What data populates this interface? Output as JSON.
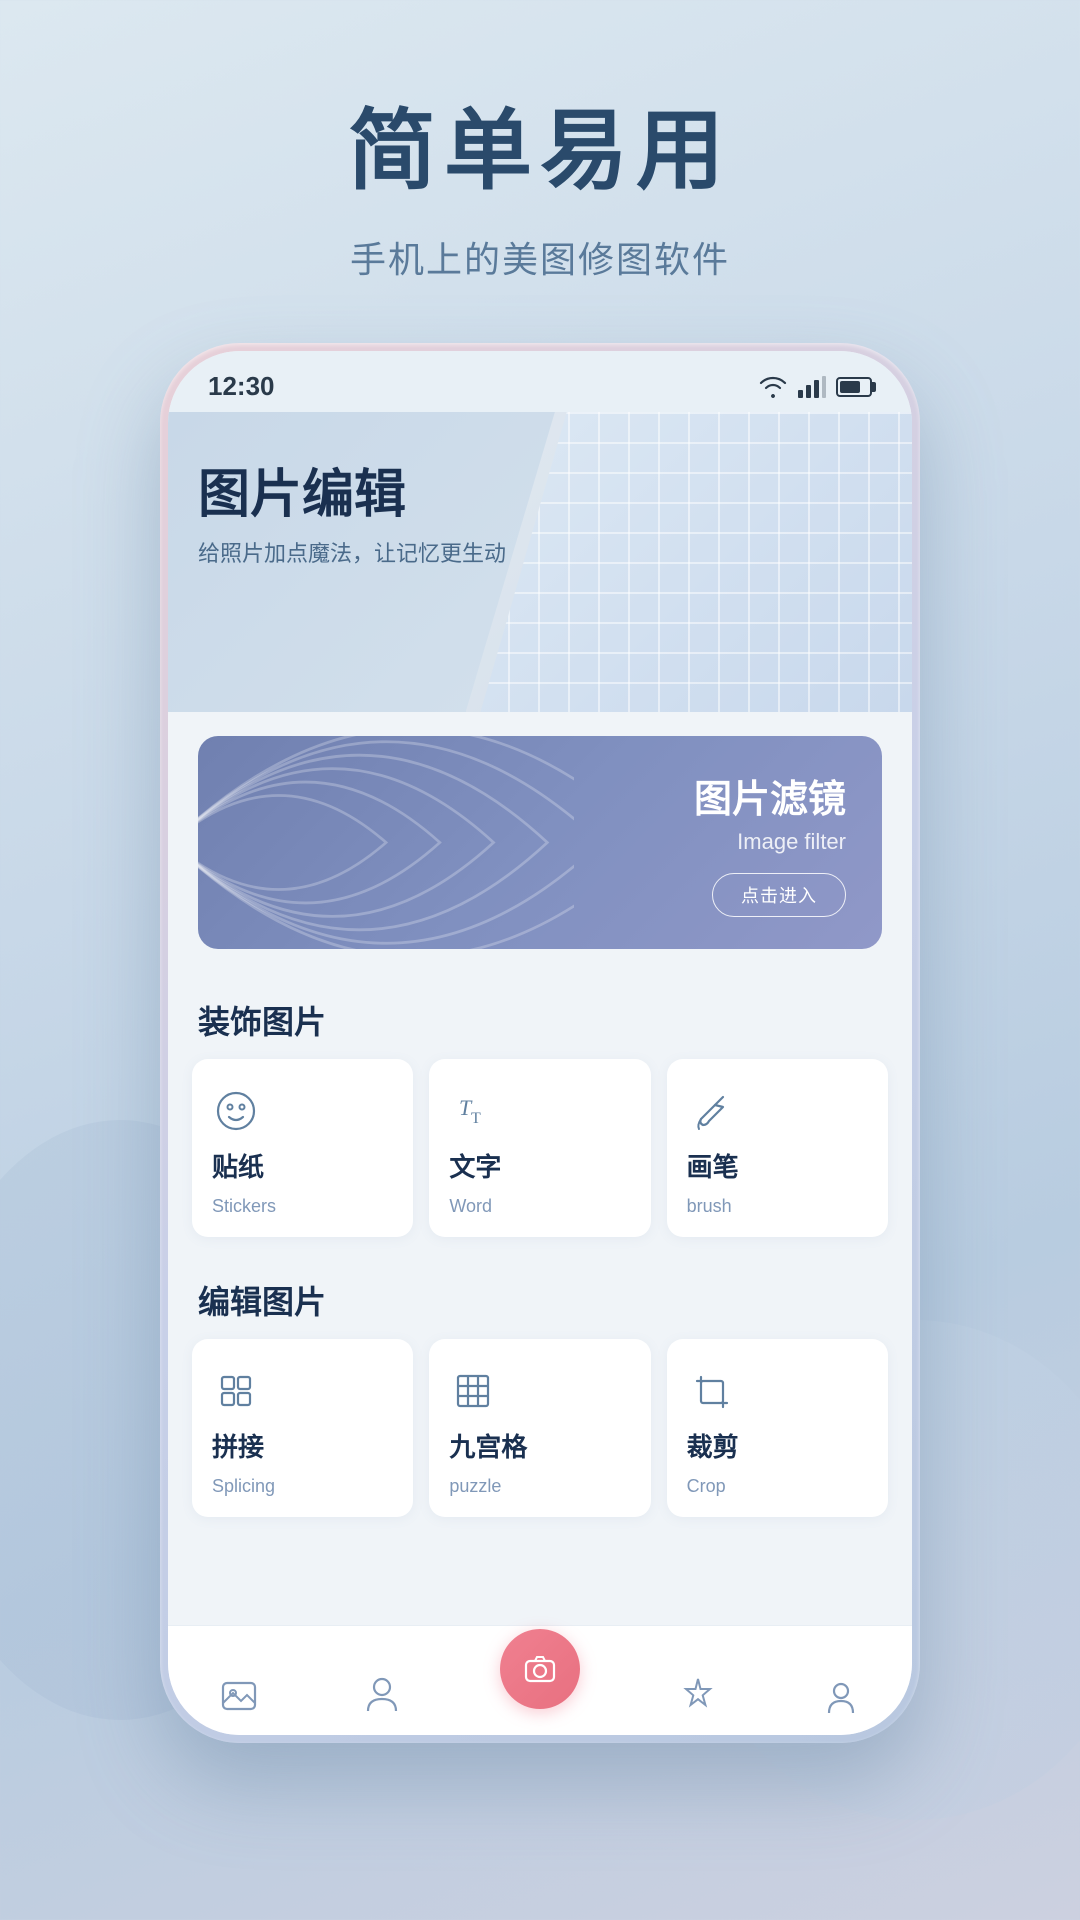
{
  "page": {
    "headline": "简单易用",
    "subtitle": "手机上的美图修图软件",
    "background_colors": {
      "top": "#dce8f0",
      "bottom": "#ccd0e0"
    }
  },
  "phone": {
    "status_bar": {
      "time": "12:30"
    },
    "hero": {
      "title": "图片编辑",
      "description": "给照片加点魔法，让记忆更生动"
    },
    "filter_banner": {
      "title": "图片滤镜",
      "subtitle": "Image filter",
      "button_label": "点击进入"
    },
    "sections": [
      {
        "id": "decorate",
        "title_zh": "装饰",
        "title_zh2": "图片",
        "features": [
          {
            "id": "stickers",
            "name_zh": "贴纸",
            "name_en": "Stickers",
            "icon": "sticker"
          },
          {
            "id": "word",
            "name_zh": "文字",
            "name_en": "Word",
            "icon": "text"
          },
          {
            "id": "brush",
            "name_zh": "画笔",
            "name_en": "brush",
            "icon": "brush"
          }
        ]
      },
      {
        "id": "edit",
        "title_zh": "编辑",
        "title_zh2": "图片",
        "features": [
          {
            "id": "splice",
            "name_zh": "拼接",
            "name_en": "Splicing",
            "icon": "splice"
          },
          {
            "id": "puzzle",
            "name_zh": "九宫格",
            "name_en": "puzzle",
            "icon": "puzzle"
          },
          {
            "id": "crop",
            "name_zh": "裁剪",
            "name_en": "Crop",
            "icon": "crop"
          }
        ]
      }
    ],
    "bottom_nav": [
      {
        "id": "gallery",
        "icon": "gallery"
      },
      {
        "id": "person",
        "icon": "person"
      },
      {
        "id": "home-center",
        "icon": "camera",
        "is_center": true
      },
      {
        "id": "effects",
        "icon": "effects"
      },
      {
        "id": "profile",
        "icon": "profile"
      }
    ]
  }
}
